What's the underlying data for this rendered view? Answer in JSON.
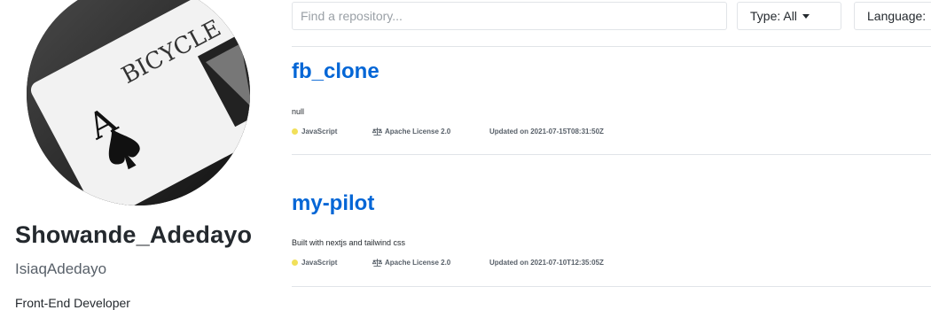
{
  "profile": {
    "name": "Showande_Adedayo",
    "username": "IsiaqAdedayo",
    "bio": "Front-End Developer"
  },
  "filters": {
    "search_placeholder": "Find a repository...",
    "type_label": "Type: All",
    "language_label": "Language:"
  },
  "repos": [
    {
      "name": "fb_clone",
      "description": "null",
      "language": "JavaScript",
      "license": "Apache License 2.0",
      "updated": "Updated on 2021-07-15T08:31:50Z"
    },
    {
      "name": "my-pilot",
      "description": "Built with nextjs and tailwind css",
      "language": "JavaScript",
      "license": "Apache License 2.0",
      "updated": "Updated on 2021-07-10T12:35:05Z"
    }
  ],
  "colors": {
    "link": "#0366d6",
    "javascript": "#f1e05a",
    "border": "#e1e4e8"
  },
  "icons": {
    "license": "law-icon",
    "dropdown": "caret-down-icon"
  }
}
